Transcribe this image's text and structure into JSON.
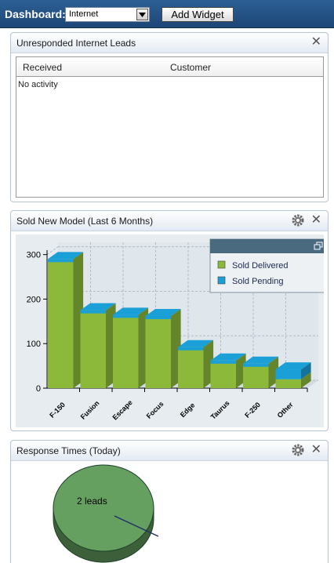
{
  "toolbar": {
    "dashboard_label": "Dashboard:",
    "dashboard_select_value": "Internet",
    "add_widget_label": "Add Widget"
  },
  "widgets": {
    "leads": {
      "title": "Unresponded Internet Leads",
      "columns": [
        "Received",
        "Customer"
      ],
      "empty_text": "No activity"
    },
    "sold": {
      "title": "Sold New Model (Last 6 Months)"
    },
    "response": {
      "title": "Response Times (Today)",
      "pie_label": "2 leads"
    }
  },
  "colors": {
    "delivered": "#8cb93a",
    "pending": "#1aa0d6",
    "pie": "#66a060"
  },
  "chart_data": [
    {
      "type": "bar",
      "stacked": true,
      "categories": [
        "F-150",
        "Fusion",
        "Escape",
        "Focus",
        "Edge",
        "Taurus",
        "F-250",
        "Other"
      ],
      "series": [
        {
          "name": "Sold Delivered",
          "values": [
            290,
            175,
            165,
            162,
            92,
            62,
            55,
            20
          ]
        },
        {
          "name": "Sold Pending",
          "values": [
            0,
            0,
            0,
            0,
            0,
            0,
            0,
            22
          ]
        }
      ],
      "ylim": [
        0,
        310
      ],
      "yticks": [
        0,
        100,
        200,
        300
      ],
      "grid": true,
      "legend": "top-right"
    },
    {
      "type": "pie",
      "slices": [
        {
          "label": "2 leads",
          "value": 2
        }
      ]
    }
  ]
}
